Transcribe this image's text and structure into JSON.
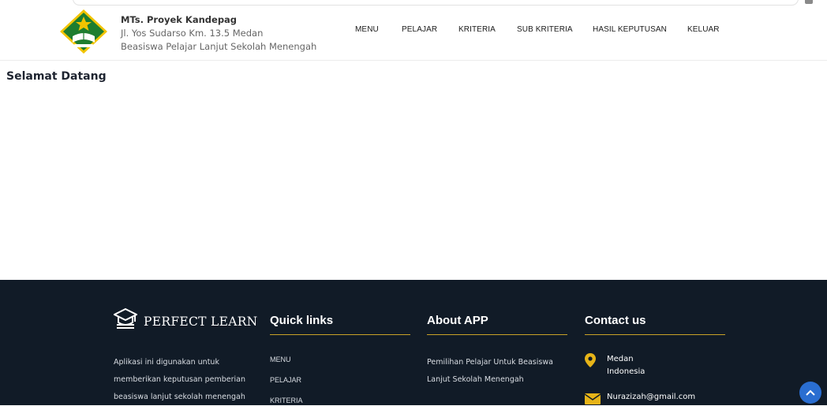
{
  "header": {
    "school_name": "MTs. Proyek Kandepag",
    "address": "Jl. Yos Sudarso Km. 13.5 Medan",
    "app_subtitle": "Beasiswa Pelajar Lanjut Sekolah Menengah",
    "logo_icon": "school-emblem-icon"
  },
  "nav": {
    "items": [
      "MENU",
      "PELAJAR",
      "KRITERIA",
      "SUB KRITERIA",
      "HASIL KEPUTUSAN",
      "KELUAR"
    ]
  },
  "main": {
    "welcome": "Selamat Datang"
  },
  "footer": {
    "brand": "PERFECT LEARN",
    "brand_icon": "graduation-cap-icon",
    "description": [
      "Aplikasi ini digunakan untuk",
      "memberikan keputusan pemberian",
      "beasiswa lanjut sekolah menengah"
    ],
    "quick_links_title": "Quick links",
    "quick_links": [
      "MENU",
      "PELAJAR",
      "KRITERIA"
    ],
    "about_title": "About APP",
    "about_text": [
      "Pemilihan Pelajar Untuk Beasiswa",
      "Lanjut Sekolah Menengah"
    ],
    "contact_title": "Contact us",
    "contact_city": "Medan",
    "contact_country": "Indonesia",
    "contact_email": "Nurazizah@gmail.com",
    "back_to_top_icon": "chevron-up-icon"
  },
  "colors": {
    "footer_bg": "#111b27",
    "accent_gold": "#c9a227",
    "back_to_top": "#2a6ed1"
  }
}
